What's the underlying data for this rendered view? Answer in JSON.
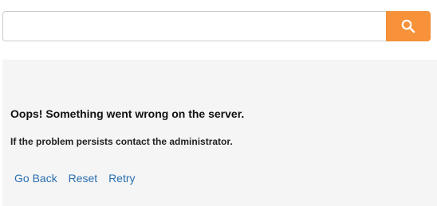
{
  "search": {
    "value": "",
    "placeholder": "",
    "button_icon": "search-icon",
    "button_color": "#f7923a"
  },
  "error": {
    "title": "Oops! Something went wrong on the server.",
    "message": "If the problem persists contact the administrator.",
    "panel_color": "#f5f5f5"
  },
  "actions": {
    "go_back": "Go Back",
    "reset": "Reset",
    "retry": "Retry",
    "link_color": "#2a6fb0"
  }
}
